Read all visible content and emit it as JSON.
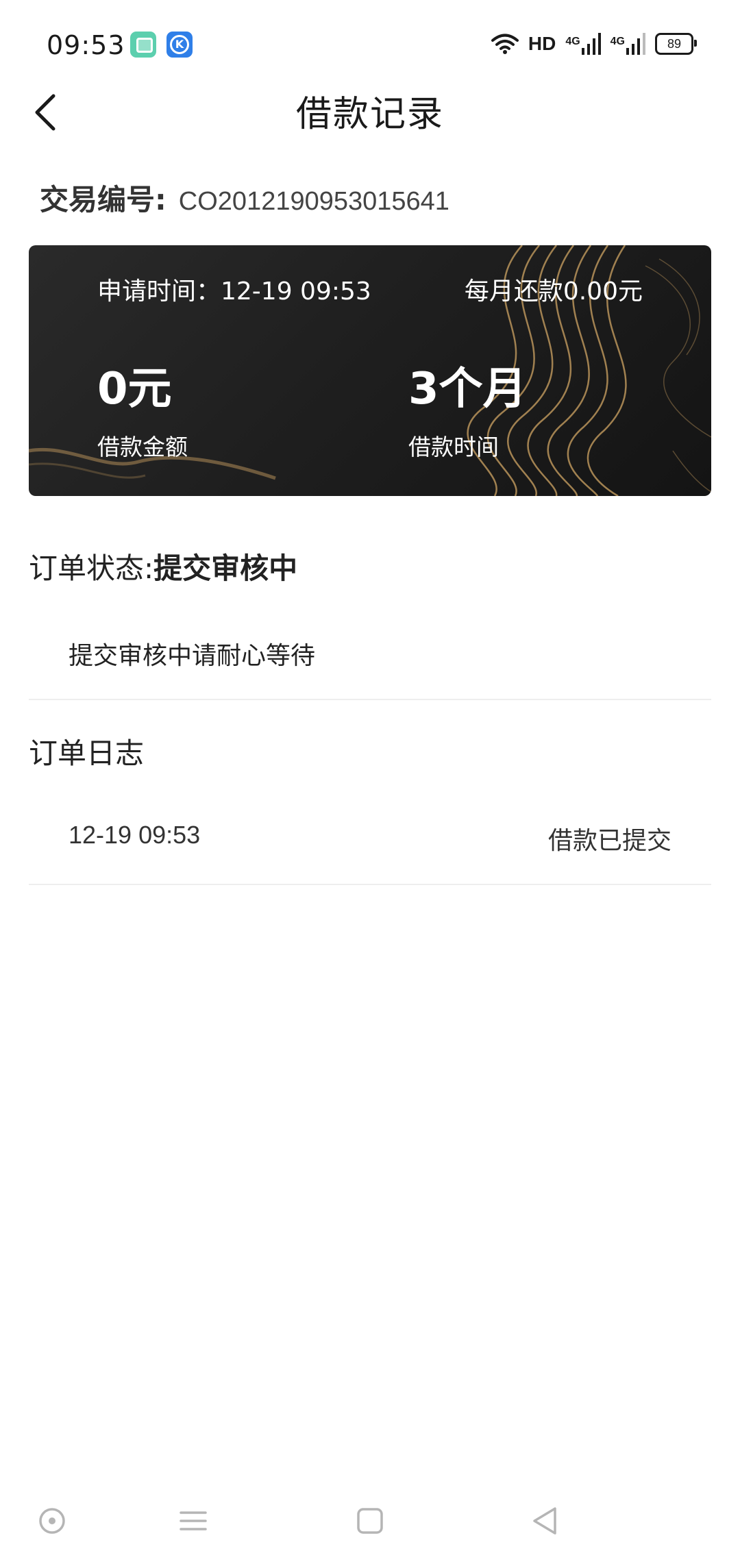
{
  "status_bar": {
    "time": "09:53",
    "apps": [
      "notes-app-icon",
      "k-app-icon"
    ],
    "k_app_letter": "K",
    "hd_label": "HD",
    "sim1_label": "4G",
    "sim2_label": "4G",
    "battery_level": "89"
  },
  "header": {
    "title": "借款记录",
    "back_icon": "chevron-left-icon"
  },
  "transaction": {
    "label": "交易编号:",
    "number": "CO2012190953015641"
  },
  "loan_card": {
    "apply_time": "申请时间：12-19 09:53",
    "monthly_repayment": "每月还款0.00元",
    "amount": "0元",
    "amount_label": "借款金额",
    "term": "3个月",
    "term_label": "借款时间",
    "accent_color": "#b08d57"
  },
  "order_status": {
    "label": "订单状态:",
    "value": "提交审核中",
    "detail": "提交审核中请耐心等待"
  },
  "order_log": {
    "heading": "订单日志",
    "entries": [
      {
        "time": "12-19 09:53",
        "event": "借款已提交"
      }
    ]
  },
  "nav_bar": {
    "buttons": [
      "assistant-dot-icon",
      "menu-icon",
      "home-square-icon",
      "back-triangle-icon"
    ]
  }
}
